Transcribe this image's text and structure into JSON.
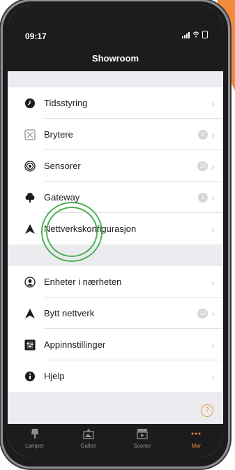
{
  "status": {
    "time": "09:17"
  },
  "header": {
    "title": "Showroom"
  },
  "group1": [
    {
      "label": "Tidsstyring",
      "icon": "clock-icon",
      "badge": null
    },
    {
      "label": "Brytere",
      "icon": "switch-icon",
      "badge": "9"
    },
    {
      "label": "Sensorer",
      "icon": "sensor-icon",
      "badge": "10"
    },
    {
      "label": "Gateway",
      "icon": "gateway-icon",
      "badge": "1"
    },
    {
      "label": "Nettverkskonfigurasjon",
      "icon": "network-icon",
      "badge": null
    }
  ],
  "group2": [
    {
      "label": "Enheter i nærheten",
      "icon": "nearby-devices-icon",
      "badge": null
    },
    {
      "label": "Bytt nettverk",
      "icon": "network-icon",
      "badge": "12"
    },
    {
      "label": "Appinnstillinger",
      "icon": "app-settings-icon",
      "badge": null
    },
    {
      "label": "Hjelp",
      "icon": "info-icon",
      "badge": null
    }
  ],
  "help_symbol": "?",
  "tabs": [
    {
      "label": "Lamper",
      "icon": "lamp-icon",
      "active": false
    },
    {
      "label": "Galleri",
      "icon": "gallery-icon",
      "active": false
    },
    {
      "label": "Scener",
      "icon": "scene-icon",
      "active": false
    },
    {
      "label": "Mer",
      "icon": "more-icon",
      "active": true
    }
  ],
  "colors": {
    "accent": "#f08a3c",
    "highlight": "#4cb050",
    "background": "#ececf0"
  }
}
